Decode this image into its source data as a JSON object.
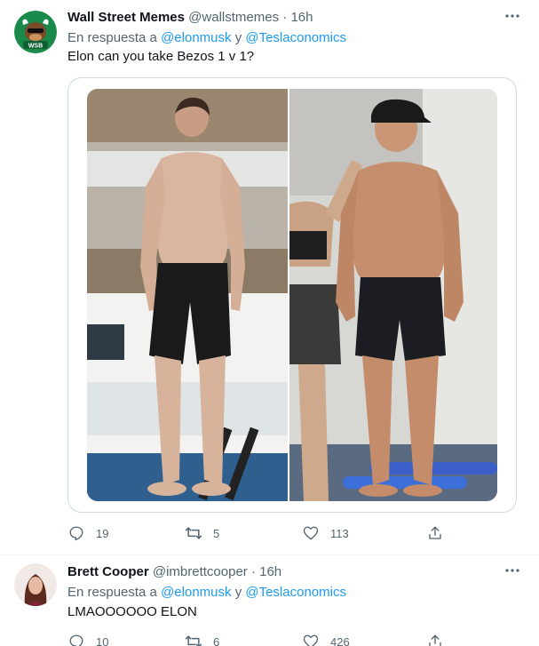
{
  "tweets": [
    {
      "display_name": "Wall Street Memes",
      "handle": "@wallstmemes",
      "separator": "·",
      "time": "16h",
      "reply_prefix": "En respuesta a",
      "reply_mention_1": "@elonmusk",
      "reply_joiner": "y",
      "reply_mention_2": "@Teslaconomics",
      "text": "Elon can you take Bezos 1 v 1?",
      "avatar_label": "WSB",
      "avatar_color": "#1a8a4a",
      "replies": "19",
      "retweets": "5",
      "likes": "113"
    },
    {
      "display_name": "Brett Cooper",
      "handle": "@imbrettcooper",
      "separator": "·",
      "time": "16h",
      "reply_prefix": "En respuesta a",
      "reply_mention_1": "@elonmusk",
      "reply_joiner": "y",
      "reply_mention_2": "@Teslaconomics",
      "text": "LMAOOOOOO ELON",
      "replies": "10",
      "retweets": "6",
      "likes": "426"
    }
  ],
  "icons": {
    "more": "more-icon",
    "reply": "reply-icon",
    "retweet": "retweet-icon",
    "like": "heart-icon",
    "share": "share-icon"
  },
  "colors": {
    "link": "#1d9bf0",
    "secondary_text": "#536471",
    "primary_text": "#0f1419",
    "border": "#cfd9de"
  }
}
